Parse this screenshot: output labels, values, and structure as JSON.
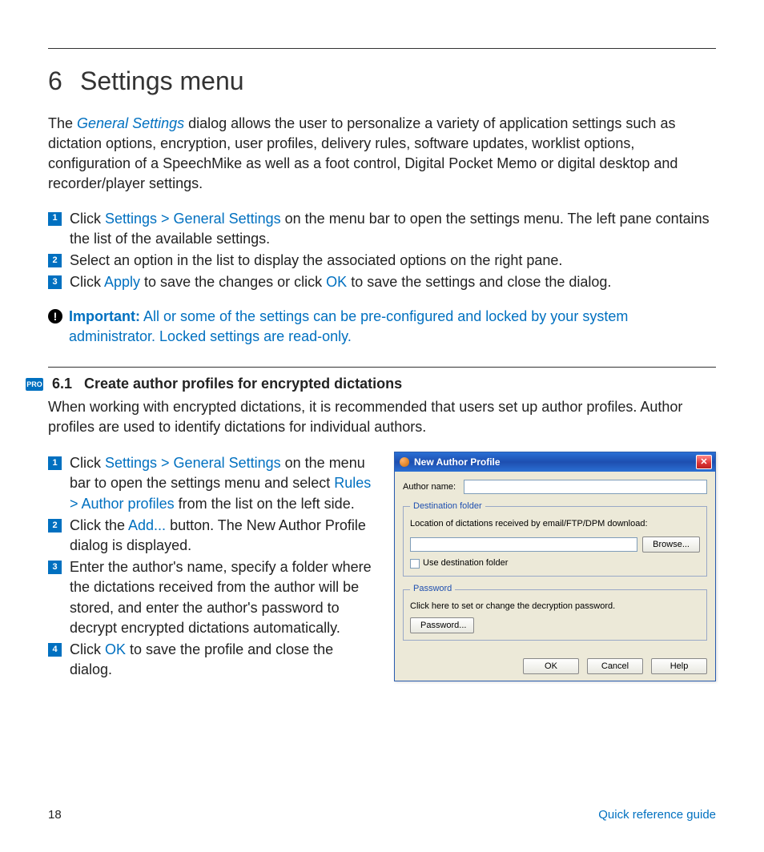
{
  "chapter": {
    "num": "6",
    "title": "Settings menu"
  },
  "intro": {
    "prefix": "The ",
    "link": "General Settings",
    "suffix": " dialog allows the user to personalize a variety of application settings such as dictation options, encryption, user profiles, delivery rules, software updates, worklist options, configuration of a SpeechMike as well as a foot control, Digital Pocket Memo or digital desktop and recorder/player settings."
  },
  "steps1": {
    "s1a": "Click ",
    "s1link": "Settings > General Settings",
    "s1b": " on the menu bar to open the settings menu. The left pane contains the list of the available settings.",
    "s2": "Select an option in the list to display the associated options on the right pane.",
    "s3a": "Click ",
    "s3apply": "Apply",
    "s3b": " to save the changes or click ",
    "s3ok": "OK",
    "s3c": " to save the settings and close the dialog."
  },
  "important": {
    "label": "Important:",
    "text": " All or some of the settings can be pre-configured and locked by your system administrator. Locked settings are read-only."
  },
  "pro_badge": "PRO",
  "subsection": {
    "num": "6.1",
    "title": "Create author profiles for encrypted dictations"
  },
  "sub_intro": "When working with encrypted dictations, it is recommended that users set up author profiles. Author profiles are used to identify dictations for individual authors.",
  "steps2": {
    "s1a": "Click ",
    "s1link1": "Settings > General Settings",
    "s1b": " on the menu bar to open the settings menu and select ",
    "s1link2": "Rules > Author profiles",
    "s1c": " from the list on the left side.",
    "s2a": "Click the ",
    "s2link": "Add...",
    "s2b": " button. The New Author Profile dialog is displayed.",
    "s3": "Enter the author's name, specify a folder where the dictations received from the author will be stored, and enter the author's password to decrypt encrypted dictations automatically.",
    "s4a": "Click ",
    "s4link": "OK",
    "s4b": " to save the profile and close the dialog."
  },
  "dialog": {
    "title": "New Author Profile",
    "author_label": "Author name:",
    "dest_legend": "Destination folder",
    "dest_desc": "Location of dictations received by email/FTP/DPM download:",
    "browse": "Browse...",
    "use_dest": "Use destination folder",
    "pw_legend": "Password",
    "pw_desc": "Click here to set or change the decryption password.",
    "pw_btn": "Password...",
    "ok": "OK",
    "cancel": "Cancel",
    "help": "Help"
  },
  "footer": {
    "page": "18",
    "guide": "Quick reference guide"
  }
}
